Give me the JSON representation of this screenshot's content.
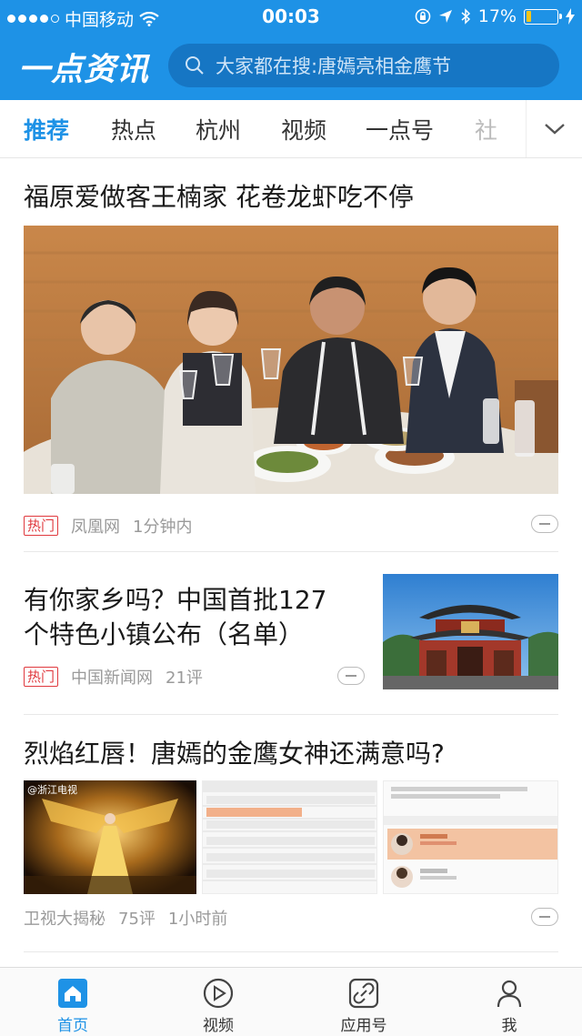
{
  "status_bar": {
    "carrier": "中国移动",
    "time": "00:03",
    "battery": "17%",
    "battery_level": 0.17,
    "icons": [
      "signal-dots-icon",
      "wifi-icon",
      "lock-rotation-icon",
      "location-icon",
      "bluetooth-icon",
      "battery-icon",
      "charging-icon"
    ]
  },
  "header": {
    "logo": "一点资讯",
    "search_placeholder": "大家都在搜:唐嫣亮相金鹰节"
  },
  "tabs": [
    "推荐",
    "热点",
    "杭州",
    "视频",
    "一点号",
    "社"
  ],
  "articles": [
    {
      "title": "福原爱做客王楠家 花卷龙虾吃不停",
      "badge": "热门",
      "source": "凤凰网",
      "time": "1分钟内"
    },
    {
      "title_line1": "有你家乡吗？中国首批127",
      "title_line2": "个特色小镇公布（名单）",
      "badge": "热门",
      "source": "中国新闻网",
      "comments": "21评"
    },
    {
      "title": "烈焰红唇！唐嫣的金鹰女神还满意吗?",
      "source": "卫视大揭秘",
      "comments": "75评",
      "time": "1小时前",
      "thumb1_caption": "@浙江电视"
    }
  ],
  "bottom_nav": [
    {
      "label": "首页",
      "icon": "home-icon",
      "active": true
    },
    {
      "label": "视频",
      "icon": "play-icon",
      "active": false
    },
    {
      "label": "应用号",
      "icon": "link-icon",
      "active": false
    },
    {
      "label": "我",
      "icon": "person-icon",
      "active": false
    }
  ],
  "colors": {
    "brand": "#1e92e6",
    "hot": "#e0393e"
  }
}
